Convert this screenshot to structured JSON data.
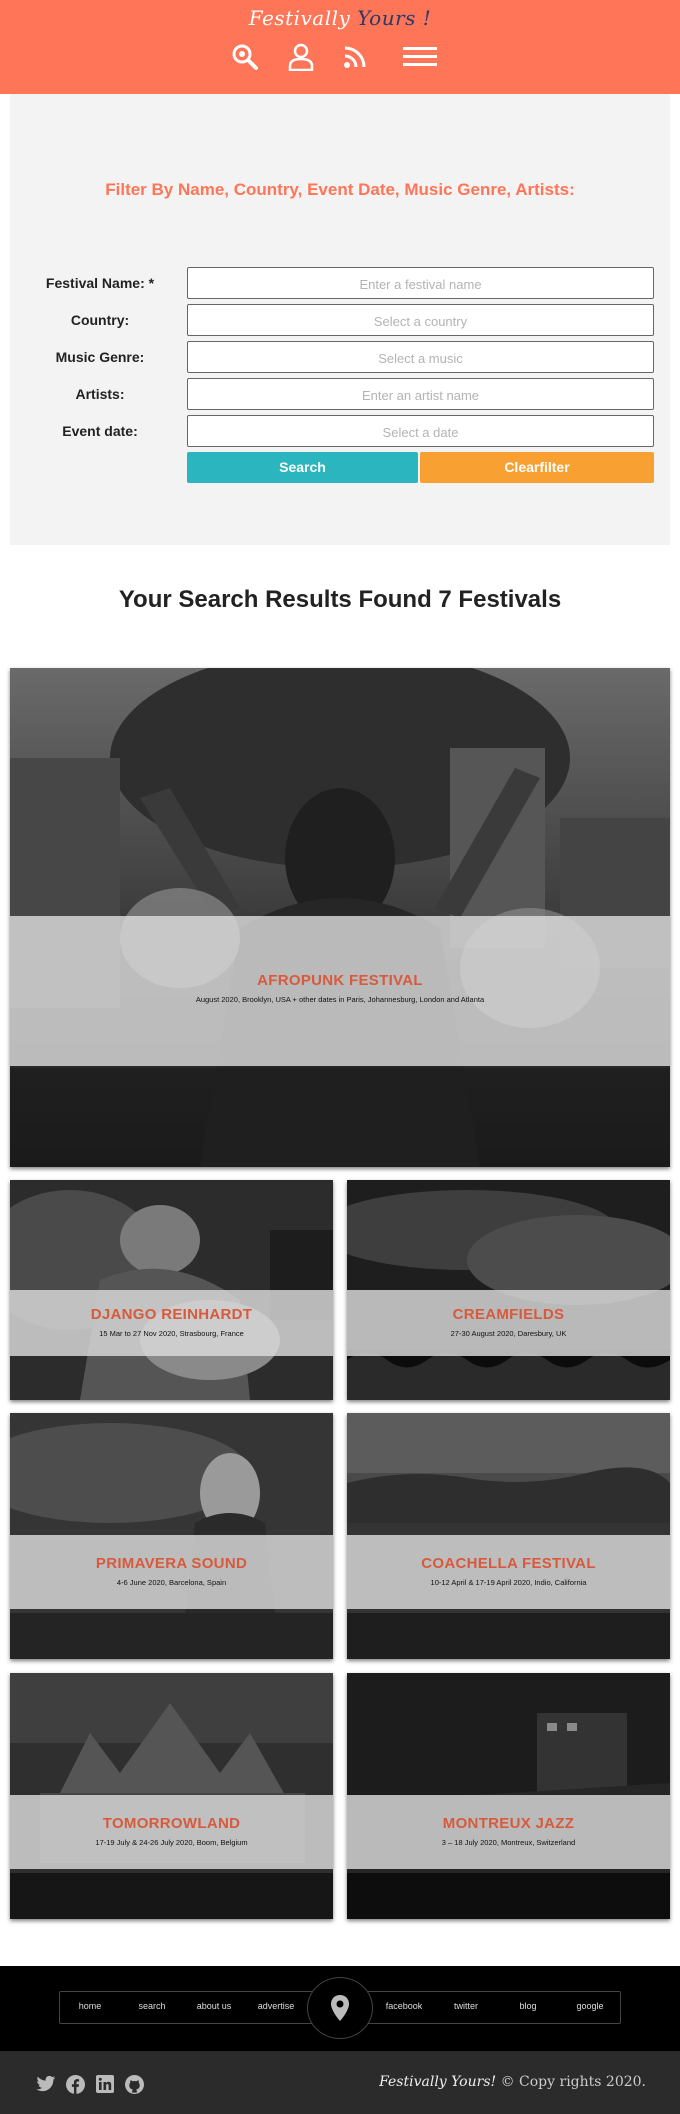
{
  "header": {
    "logo_first": "Festivally",
    "logo_second": "Yours !",
    "icons": [
      "search-icon",
      "user-icon",
      "rss-icon",
      "menu-icon"
    ]
  },
  "filter": {
    "title": "Filter By Name, Country, Event Date, Music Genre, Artists:",
    "fields": [
      {
        "label": "Festival Name: *",
        "placeholder": "Enter a festival name"
      },
      {
        "label": "Country:",
        "placeholder": "Select a country"
      },
      {
        "label": "Music Genre:",
        "placeholder": "Select a music"
      },
      {
        "label": "Artists:",
        "placeholder": "Enter an artist name"
      },
      {
        "label": "Event date:",
        "placeholder": "Select a date"
      }
    ],
    "search_label": "Search",
    "clear_label": "Clearfilter"
  },
  "results": {
    "heading": "Your Search Results Found 7 Festivals",
    "cards": [
      {
        "title": "AFROPUNK FESTIVAL",
        "date": "August 2020, Brooklyn, USA + other dates in Paris, Johannesburg, London and Atlanta"
      },
      {
        "title": "DJANGO REINHARDT",
        "date": "15 Mar to 27 Nov 2020, Strasbourg, France"
      },
      {
        "title": "CREAMFIELDS",
        "date": "27-30 August 2020, Daresbury, UK"
      },
      {
        "title": "PRIMAVERA SOUND",
        "date": "4-6 June 2020, Barcelona, Spain"
      },
      {
        "title": "COACHELLA FESTIVAL",
        "date": "10-12 April & 17-19 April 2020, Indio, California"
      },
      {
        "title": "TOMORROWLAND",
        "date": "17-19 July & 24-26 July 2020, Boom, Belgium"
      },
      {
        "title": "MONTREUX JAZZ",
        "date": "3 – 18 July 2020, Montreux, Switzerland"
      }
    ]
  },
  "footer": {
    "links": [
      "home",
      "search",
      "about us",
      "advertise",
      "facebook",
      "twitter",
      "blog",
      "google"
    ],
    "social_icons": [
      "twitter-icon",
      "facebook-icon",
      "linkedin-icon",
      "github-icon"
    ],
    "brand": "Festivally Yours!",
    "copyright": "© Copy rights 2020."
  },
  "colors": {
    "accent": "#fe7557",
    "search_button": "#2bb5bf",
    "clear_button": "#f9a033",
    "card_title": "#d85a3c"
  }
}
